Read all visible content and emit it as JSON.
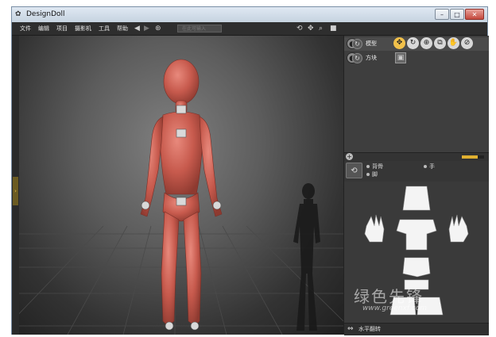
{
  "window": {
    "title": "DesignDoll",
    "app_icon": "doll-app-icon"
  },
  "window_buttons": {
    "minimize": "–",
    "maximize": "□",
    "close": "✕"
  },
  "menu": {
    "items": [
      "文件",
      "编辑",
      "项目",
      "摄影机",
      "工具",
      "帮助"
    ]
  },
  "toolbar": {
    "command_placeholder": "在此可输入"
  },
  "scene_tree": {
    "rows": [
      {
        "label": "模型",
        "selected": true
      },
      {
        "label": "方块",
        "selected": false
      }
    ]
  },
  "panel": {
    "slider_value": 0.7
  },
  "parts": {
    "options": [
      "背骨",
      "手",
      "脚"
    ]
  },
  "bottom_bar": {
    "flip_label": "水平翻转"
  },
  "watermark": {
    "text": "绿色先锋",
    "url": "www.greenxf.com"
  },
  "colors": {
    "doll": "#c75a4d",
    "accent": "#f2c14a",
    "ui_dark": "#3b3b3b"
  }
}
